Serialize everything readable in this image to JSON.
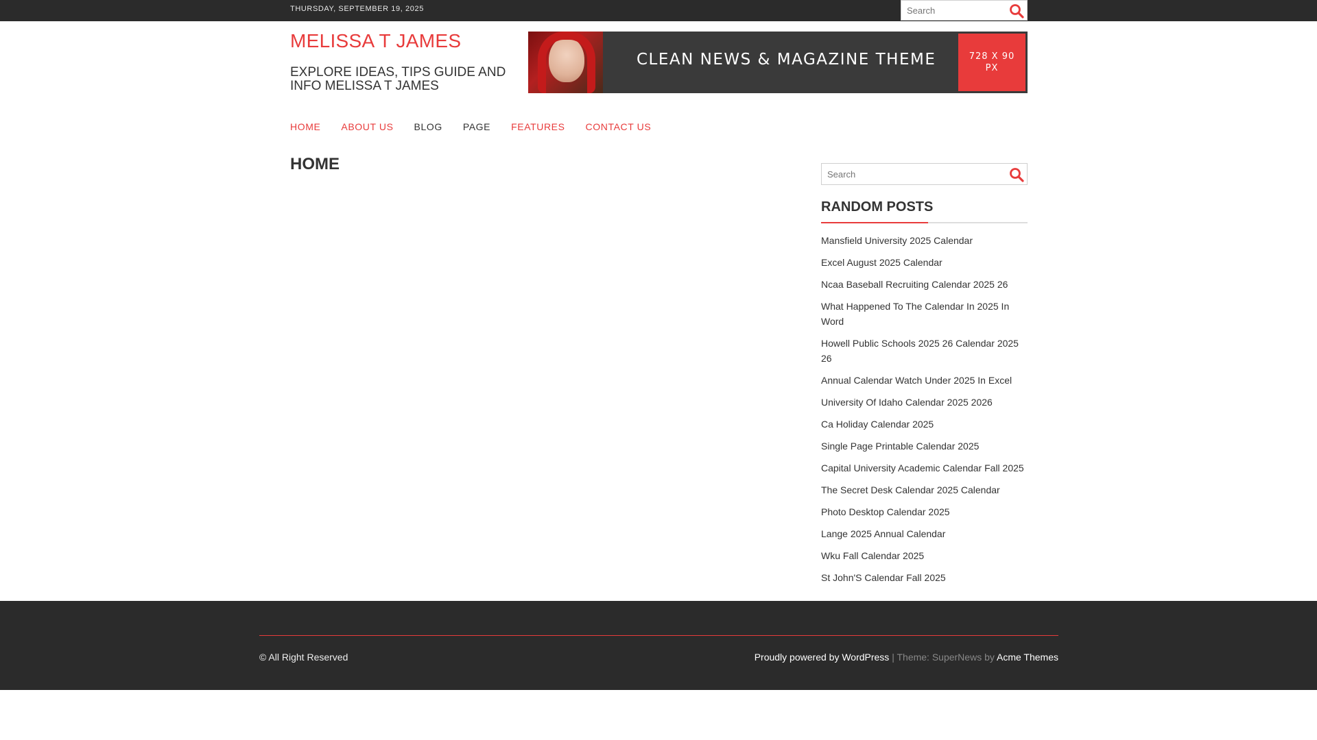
{
  "topbar": {
    "date": "THURSDAY, SEPTEMBER 19, 2025",
    "search_placeholder": "Search"
  },
  "header": {
    "site_title": "MELISSA T JAMES",
    "site_description": "EXPLORE IDEAS, TIPS GUIDE AND INFO MELISSA T JAMES"
  },
  "banner": {
    "tagline": "CLEAN NEWS & MAGAZINE THEME",
    "size_line1": "728 X 90",
    "size_line2": "PX"
  },
  "nav": {
    "items": [
      {
        "label": "HOME"
      },
      {
        "label": "ABOUT US"
      },
      {
        "label": "BLOG"
      },
      {
        "label": "PAGE"
      },
      {
        "label": "FEATURES"
      },
      {
        "label": "CONTACT US"
      }
    ]
  },
  "main": {
    "heading": "HOME"
  },
  "sidebar": {
    "search_placeholder": "Search",
    "widget_title": "RANDOM POSTS",
    "posts": [
      "Mansfield University 2025 Calendar",
      "Excel August 2025 Calendar",
      "Ncaa Baseball Recruiting Calendar 2025 26",
      "What Happened To The Calendar In 2025 In Word",
      "Howell Public Schools 2025 26 Calendar 2025 26",
      "Annual Calendar Watch Under 2025 In Excel",
      "University Of Idaho Calendar 2025 2026",
      "Ca Holiday Calendar 2025",
      "Single Page Printable Calendar 2025",
      "Capital University Academic Calendar Fall 2025",
      "The Secret Desk Calendar 2025 Calendar",
      "Photo Desktop Calendar 2025",
      "Lange 2025 Annual Calendar",
      "Wku Fall Calendar 2025",
      "St John'S Calendar Fall 2025"
    ]
  },
  "footer": {
    "copyright": "© All Right Reserved",
    "powered_by": "Proudly powered by WordPress",
    "separator": " | Theme: SuperNews by ",
    "theme_author": "Acme Themes"
  },
  "colors": {
    "accent": "#e83b3b",
    "topbar_bg": "#2b2b2b",
    "footer_bg": "#2b2b2b"
  }
}
